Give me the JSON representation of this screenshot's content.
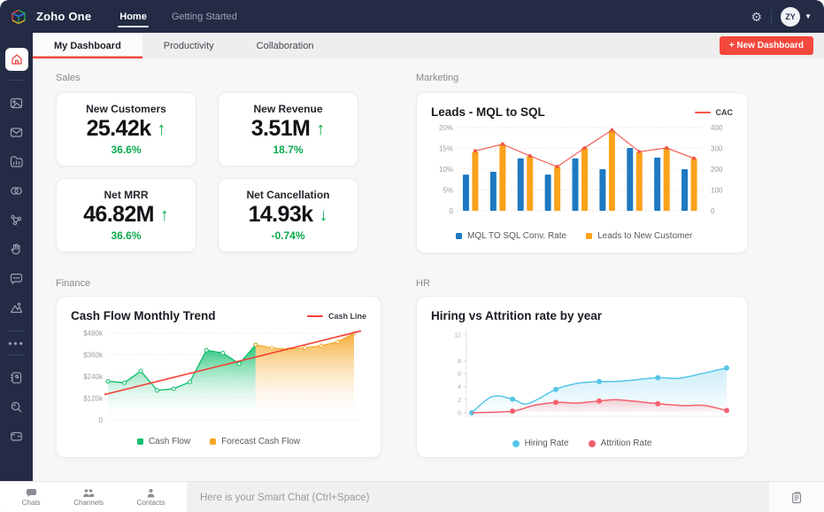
{
  "topbar": {
    "brand": "Zoho One",
    "nav": [
      {
        "label": "Home",
        "active": true
      },
      {
        "label": "Getting Started",
        "active": false
      }
    ],
    "avatar_initials": "ZY"
  },
  "tabbar": {
    "tabs": [
      {
        "label": "My Dashboard",
        "active": true
      },
      {
        "label": "Productivity",
        "active": false
      },
      {
        "label": "Collaboration",
        "active": false
      }
    ],
    "new_dashboard_label": "+ New Dashboard"
  },
  "sidebar": {
    "icons": [
      "home",
      "gallery",
      "mail",
      "folder-chart",
      "rings",
      "share-network",
      "hand-gesture",
      "chat-bubble",
      "analytics-mountain",
      "more-dots",
      "notebook",
      "search",
      "wallet"
    ]
  },
  "sections": {
    "sales": {
      "title": "Sales",
      "cards": [
        {
          "label": "New Customers",
          "value": "25.42k",
          "arrow": "↑",
          "delta": "36.6%"
        },
        {
          "label": "New Revenue",
          "value": "3.51M",
          "arrow": "↑",
          "delta": "18.7%"
        },
        {
          "label": "Net MRR",
          "value": "46.82M",
          "arrow": "↑",
          "delta": "36.6%"
        },
        {
          "label": "Net Cancellation",
          "value": "14.93k",
          "arrow": "↓",
          "delta": "-0.74%"
        }
      ]
    },
    "marketing": {
      "title": "Marketing"
    },
    "finance": {
      "title": "Finance"
    },
    "hr": {
      "title": "HR"
    }
  },
  "chart_data": [
    {
      "id": "leads_mql_to_sql",
      "type": "bar",
      "title": "Leads - MQL to SQL",
      "top_legend": {
        "label": "CAC",
        "color": "#F2554B"
      },
      "left_axis": {
        "labels": [
          "20%",
          "15%",
          "10%",
          "5%",
          "0"
        ],
        "max": 20
      },
      "right_axis": {
        "labels": [
          "400",
          "300",
          "200",
          "100",
          "0"
        ],
        "max": 400
      },
      "series": [
        {
          "name": "MQL TO SQL Conv. Rate",
          "type": "bar",
          "axis": "left",
          "color": "#1E79C2",
          "values": [
            8.7,
            9.4,
            12.6,
            8.7,
            12.6,
            10,
            15.1,
            12.8,
            10
          ]
        },
        {
          "name": "Leads to New Customer",
          "type": "bar",
          "axis": "left",
          "color": "#FAA21B",
          "values": [
            14.2,
            16,
            13.2,
            10.6,
            15.1,
            19.3,
            14.1,
            15.1,
            12.6
          ]
        },
        {
          "name": "CAC",
          "type": "line",
          "axis": "right",
          "color": "#F2554B",
          "values": [
            288,
            320,
            264,
            212,
            302,
            388,
            284,
            302,
            252
          ]
        }
      ]
    },
    {
      "id": "cash_flow_monthly_trend",
      "type": "area",
      "title": "Cash Flow Monthly Trend",
      "top_legend": {
        "label": "Cash Line",
        "color": "#F43F35"
      },
      "y_axis": {
        "labels": [
          "$480k",
          "$360k",
          "$240k",
          "$120k",
          "0"
        ],
        "max": 480
      },
      "series": [
        {
          "name": "Cash Flow",
          "type": "area",
          "color": "#13BF6E",
          "values": [
            213,
            205,
            270,
            163,
            172,
            210,
            385,
            370,
            310,
            415
          ]
        },
        {
          "name": "Forecast Cash Flow",
          "type": "area",
          "color": "#F5A623",
          "values": [
            415,
            398,
            390,
            398,
            410,
            432,
            478
          ]
        },
        {
          "name": "Cash Line",
          "type": "line",
          "color": "#F43F35",
          "trend": [
            140,
            492
          ]
        }
      ]
    },
    {
      "id": "hiring_vs_attrition",
      "type": "line",
      "title": "Hiring vs Attrition rate by year",
      "y_axis": {
        "labels": [
          "12",
          "8",
          "6",
          "4",
          "2",
          "0"
        ],
        "values": [
          12,
          8,
          6,
          4,
          2,
          0
        ],
        "max": 12
      },
      "series": [
        {
          "name": "Hiring Rate",
          "color": "#55C6E8",
          "curve": [
            [
              0,
              0
            ],
            [
              8,
              2.5
            ],
            [
              16,
              2.1
            ],
            [
              22,
              1.4
            ],
            [
              33,
              3.6
            ],
            [
              41,
              4.5
            ],
            [
              50,
              4.8
            ],
            [
              58,
              4.85
            ],
            [
              73,
              5.4
            ],
            [
              81,
              5.3
            ],
            [
              91,
              6.1
            ],
            [
              100,
              6.9
            ]
          ],
          "dots": [
            [
              0,
              0
            ],
            [
              16,
              2.1
            ],
            [
              33,
              3.6
            ],
            [
              50,
              4.8
            ],
            [
              73,
              5.4
            ],
            [
              100,
              6.9
            ]
          ]
        },
        {
          "name": "Attrition Rate",
          "color": "#F4616F",
          "curve": [
            [
              0,
              0
            ],
            [
              16,
              0.25
            ],
            [
              24,
              1.1
            ],
            [
              33,
              1.6
            ],
            [
              41,
              1.5
            ],
            [
              50,
              1.8
            ],
            [
              57,
              2.0
            ],
            [
              73,
              1.4
            ],
            [
              83,
              1.1
            ],
            [
              91,
              1.15
            ],
            [
              100,
              0.35
            ]
          ],
          "dots": [
            [
              16,
              0.25
            ],
            [
              33,
              1.6
            ],
            [
              50,
              1.8
            ],
            [
              73,
              1.4
            ],
            [
              100,
              0.35
            ]
          ]
        }
      ]
    }
  ],
  "bottombar": {
    "tabs": [
      {
        "label": "Chats"
      },
      {
        "label": "Channels"
      },
      {
        "label": "Contacts"
      }
    ],
    "chat_placeholder": "Here is your Smart Chat (Ctrl+Space)"
  },
  "colors": {
    "topbar_bg": "#232C44",
    "accent_red": "#F4473D",
    "kpi_green": "#0AA94D",
    "page_bg": "#F7F7F8"
  }
}
